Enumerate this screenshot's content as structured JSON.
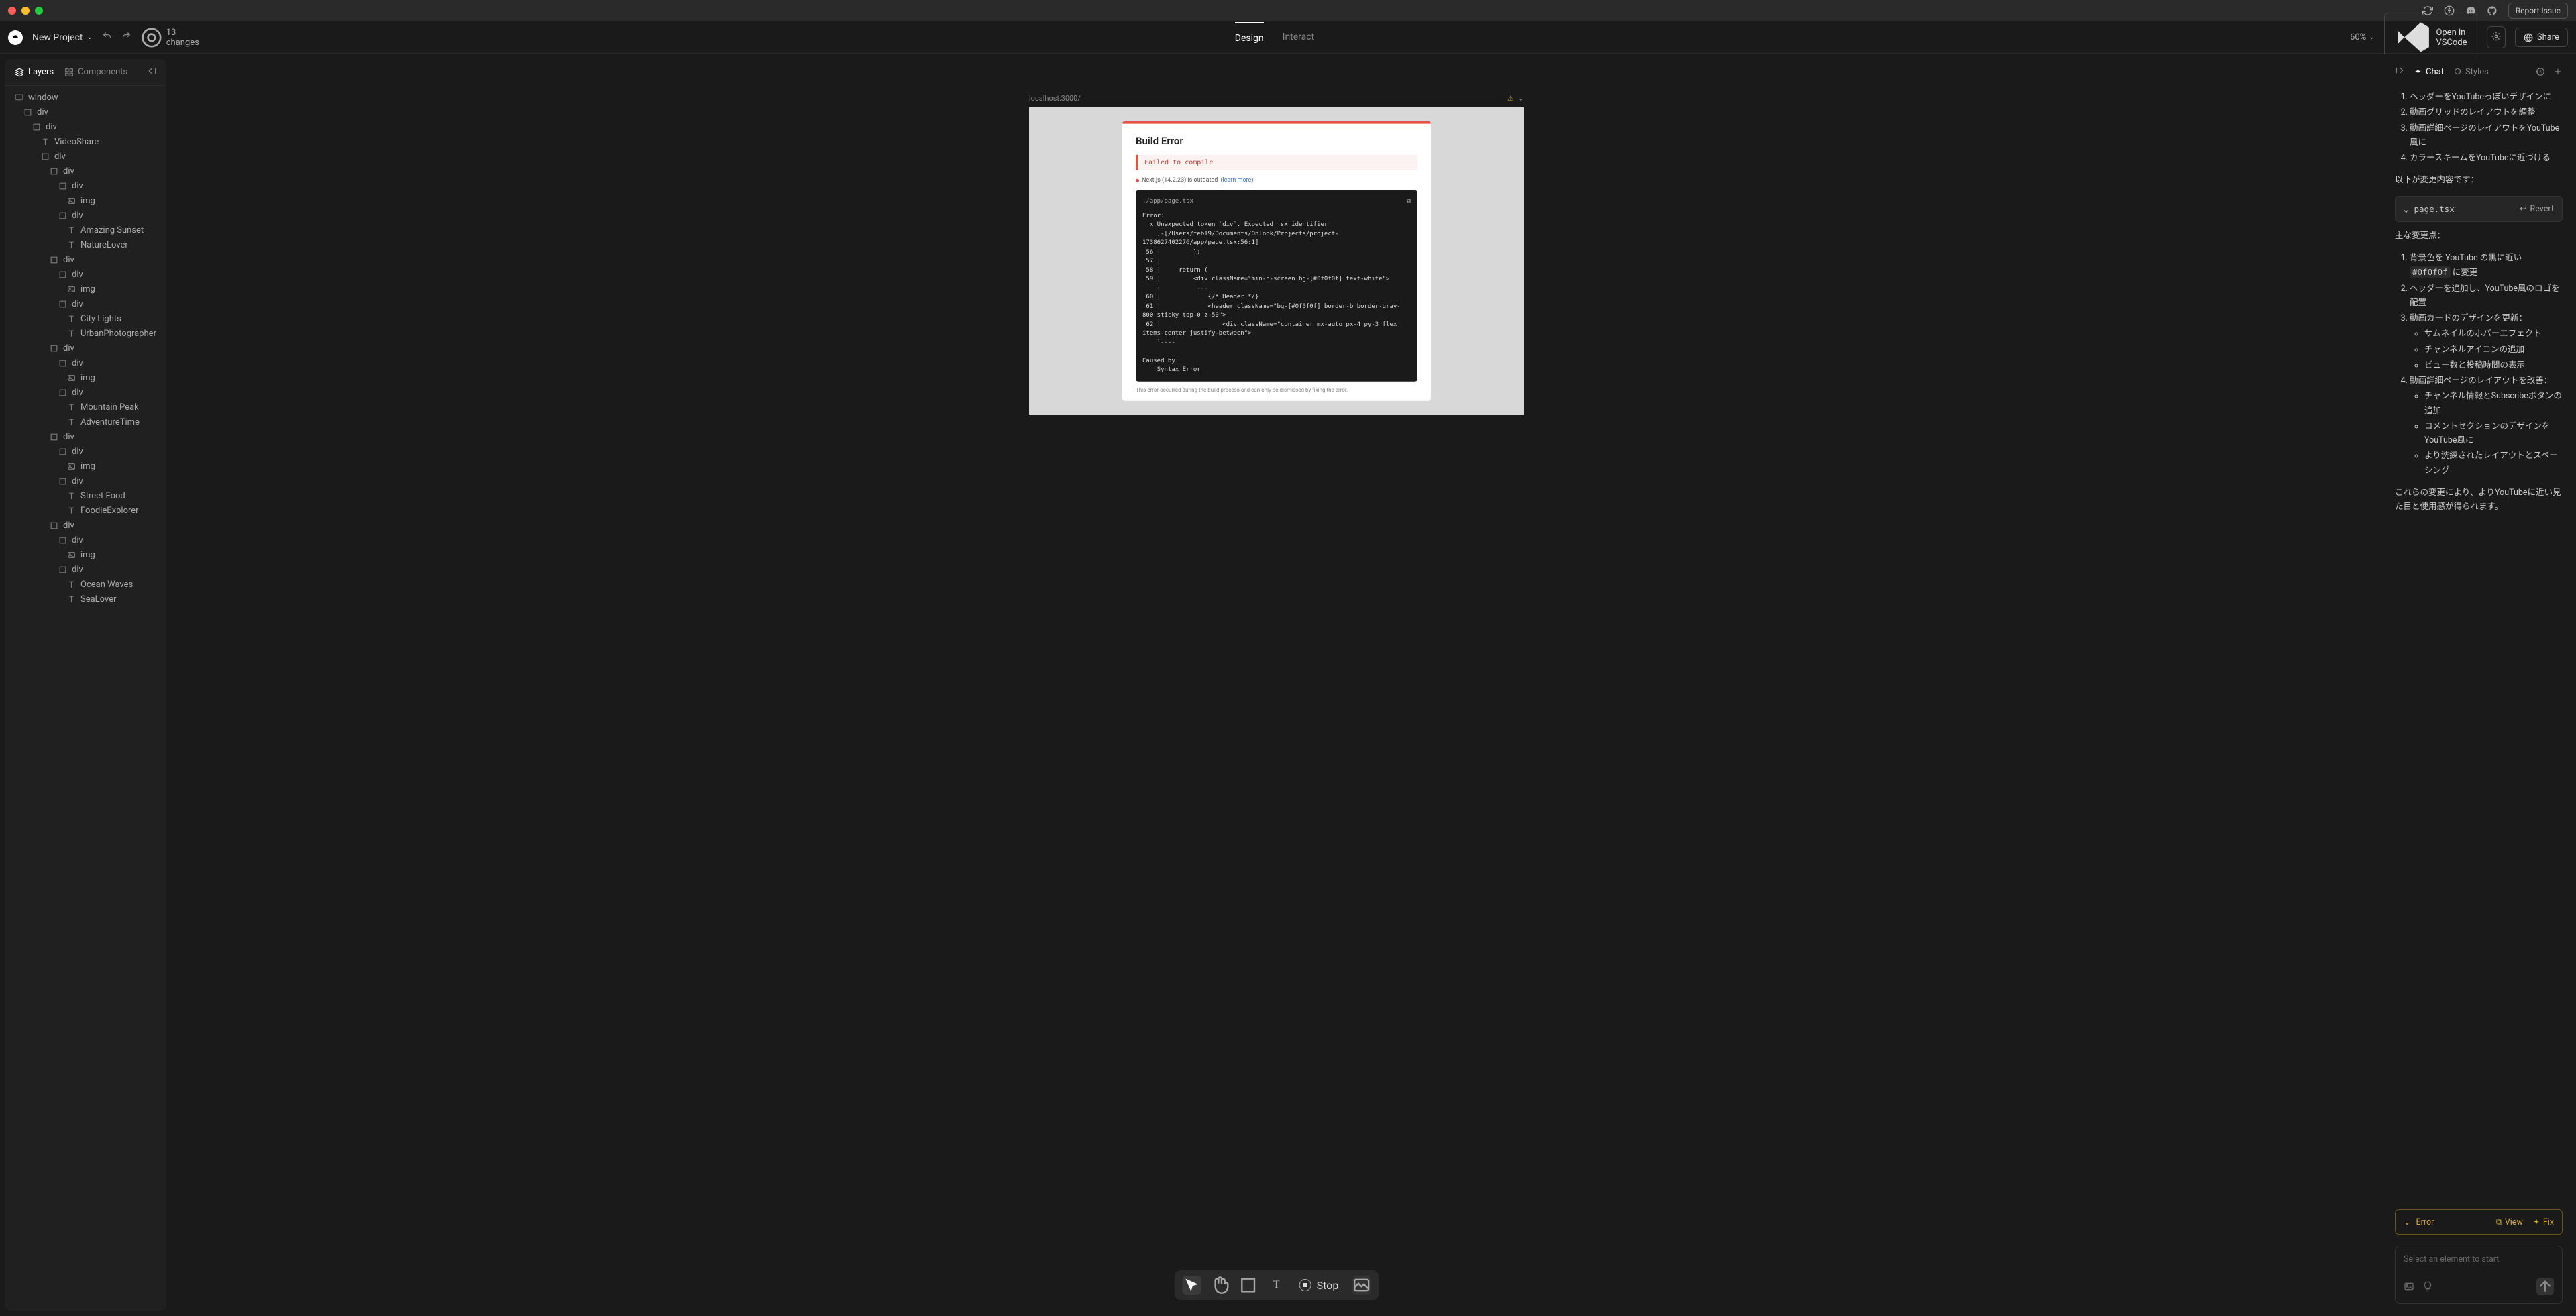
{
  "titlebar": {
    "report_issue": "Report Issue"
  },
  "toolbar": {
    "project_name": "New Project",
    "changes": "13 changes",
    "tab_design": "Design",
    "tab_interact": "Interact",
    "zoom": "60%",
    "open_vscode": "Open in VSCode",
    "share": "Share"
  },
  "left_panel": {
    "tab_layers": "Layers",
    "tab_components": "Components",
    "tree": [
      {
        "depth": 0,
        "icon": "monitor",
        "label": "window"
      },
      {
        "depth": 1,
        "icon": "box",
        "label": "div"
      },
      {
        "depth": 2,
        "icon": "box",
        "label": "div"
      },
      {
        "depth": 3,
        "icon": "text",
        "label": "VideoShare"
      },
      {
        "depth": 3,
        "icon": "box",
        "label": "div"
      },
      {
        "depth": 4,
        "icon": "box",
        "label": "div"
      },
      {
        "depth": 5,
        "icon": "box",
        "label": "div"
      },
      {
        "depth": 6,
        "icon": "img",
        "label": "img"
      },
      {
        "depth": 5,
        "icon": "box",
        "label": "div"
      },
      {
        "depth": 6,
        "icon": "text",
        "label": "Amazing Sunset"
      },
      {
        "depth": 6,
        "icon": "text",
        "label": "NatureLover"
      },
      {
        "depth": 4,
        "icon": "box",
        "label": "div"
      },
      {
        "depth": 5,
        "icon": "box",
        "label": "div"
      },
      {
        "depth": 6,
        "icon": "img",
        "label": "img"
      },
      {
        "depth": 5,
        "icon": "box",
        "label": "div"
      },
      {
        "depth": 6,
        "icon": "text",
        "label": "City Lights"
      },
      {
        "depth": 6,
        "icon": "text",
        "label": "UrbanPhotographer"
      },
      {
        "depth": 4,
        "icon": "box",
        "label": "div"
      },
      {
        "depth": 5,
        "icon": "box",
        "label": "div"
      },
      {
        "depth": 6,
        "icon": "img",
        "label": "img"
      },
      {
        "depth": 5,
        "icon": "box",
        "label": "div"
      },
      {
        "depth": 6,
        "icon": "text",
        "label": "Mountain Peak"
      },
      {
        "depth": 6,
        "icon": "text",
        "label": "AdventureTime"
      },
      {
        "depth": 4,
        "icon": "box",
        "label": "div"
      },
      {
        "depth": 5,
        "icon": "box",
        "label": "div"
      },
      {
        "depth": 6,
        "icon": "img",
        "label": "img"
      },
      {
        "depth": 5,
        "icon": "box",
        "label": "div"
      },
      {
        "depth": 6,
        "icon": "text",
        "label": "Street Food"
      },
      {
        "depth": 6,
        "icon": "text",
        "label": "FoodieExplorer"
      },
      {
        "depth": 4,
        "icon": "box",
        "label": "div"
      },
      {
        "depth": 5,
        "icon": "box",
        "label": "div"
      },
      {
        "depth": 6,
        "icon": "img",
        "label": "img"
      },
      {
        "depth": 5,
        "icon": "box",
        "label": "div"
      },
      {
        "depth": 6,
        "icon": "text",
        "label": "Ocean Waves"
      },
      {
        "depth": 6,
        "icon": "text",
        "label": "SeaLover"
      }
    ]
  },
  "preview": {
    "url": "localhost:3000/",
    "error_title": "Build Error",
    "fail_msg": "Failed to compile",
    "outdated": "Next.js (14.2.23) is outdated",
    "learn_more": "(learn more)",
    "file": "./app/page.tsx",
    "code": "Error:\n  x Unexpected token `div`. Expected jsx identifier\n    ,-[/Users/feb19/Documents/Onlook/Projects/project-1738627402276/app/page.tsx:56:1]\n 56 |         };\n 57 |\n 58 |     return (\n 59 |         <div className=\"min-h-screen bg-[#0f0f0f] text-white\">\n    :          ---\n 60 |             {/* Header */}\n 61 |             <header className=\"bg-[#0f0f0f] border-b border-gray-800 sticky top-0 z-50\">\n 62 |                 <div className=\"container mx-auto px-4 py-3 flex items-center justify-between\">\n    `----\n\nCaused by:\n    Syntax Error",
    "footer": "This error occurred during the build process and can only be dismissed by fixing the error."
  },
  "bottom_toolbar": {
    "stop": "Stop"
  },
  "right_panel": {
    "tab_chat": "Chat",
    "tab_styles": "Styles",
    "list1": [
      "ヘッダーをYouTubeっぽいデザインに",
      "動画グリッドのレイアウトを調整",
      "動画詳細ページのレイアウトをYouTube風に",
      "カラースキームをYouTubeに近づける"
    ],
    "intro2": "以下が変更内容です：",
    "file": "page.tsx",
    "revert": "Revert",
    "heading2": "主な変更点：",
    "list2": [
      "背景色を YouTube の黒に近い `#0f0f0f` に変更",
      "ヘッダーを追加し、YouTube風のロゴを配置",
      "動画カードのデザインを更新："
    ],
    "sublist2": [
      "サムネイルのホバーエフェクト",
      "チャンネルアイコンの追加",
      "ビュー数と投稿時間の表示"
    ],
    "list2b": "動画詳細ページのレイアウトを改善：",
    "sublist2b": [
      "チャンネル情報とSubscribeボタンの追加",
      "コメントセクションのデザインをYouTube風に",
      "より洗練されたレイアウトとスペーシング"
    ],
    "outro": "これらの変更により、よりYouTubeに近い見た目と使用感が得られます。",
    "error_label": "Error",
    "view": "View",
    "fix": "Fix",
    "placeholder": "Select an element to start"
  }
}
